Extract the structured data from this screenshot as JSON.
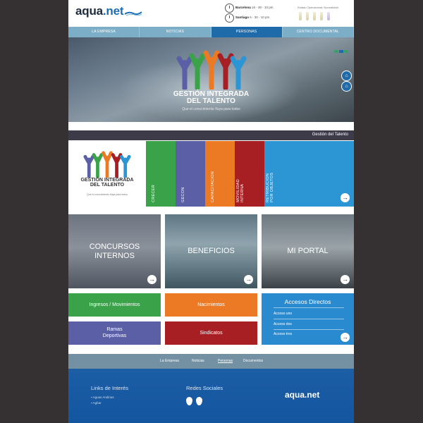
{
  "header": {
    "logo_main": "aqua",
    "logo_suffix": ".net",
    "clock1_city": "Barcelona",
    "clock1_time": "16 - 30 - 10 pm",
    "clock2_city": "Santiago",
    "clock2_time": "6 - 30 - 10 pm",
    "status_text": "Estado Operacional: Normalidad"
  },
  "nav": {
    "items": [
      "LA EMPRESA",
      "NOTICIAS",
      "PERSONAS",
      "CENTRO DOCUMENTAL"
    ],
    "active_index": 2
  },
  "hero": {
    "title_line1": "GESTIÓN INTEGRADA",
    "title_line2": "DEL TALENTO",
    "subtitle": "Que el conocimiento fluya para todos"
  },
  "strip": {
    "label": "Gestión del Talento"
  },
  "talent_tile": {
    "title_line1": "GESTIÓN INTEGRADA",
    "title_line2": "DEL TALENTO",
    "subtitle": "Que el conocimiento fluya para todos"
  },
  "color_tiles": [
    {
      "label": "CRECER",
      "color": "#3aa34a"
    },
    {
      "label": "GECON",
      "color": "#5a5fa6"
    },
    {
      "label": "CAPACITACION",
      "color": "#ec7a24"
    },
    {
      "label": "MOVILIDAD INTERNA",
      "color": "#a71f22"
    },
    {
      "label": "RETRIBUCION POR OBJETOS",
      "color": "#2c95d4"
    }
  ],
  "photo_tiles": [
    {
      "title_line1": "CONCURSOS",
      "title_line2": "INTERNOS"
    },
    {
      "title_line1": "BENEFICIOS",
      "title_line2": ""
    },
    {
      "title_line1": "MI PORTAL",
      "title_line2": ""
    }
  ],
  "small_tiles": {
    "ingresos": "Ingresos / Movimientos",
    "nacimientos": "Nacimientos",
    "ramas_line1": "Ramas",
    "ramas_line2": "Deportivas",
    "sindicatos": "Sindicatos"
  },
  "accesos": {
    "title": "Accesos Directos",
    "items": [
      "Acceso uno",
      "Acceso dos",
      "Acceso tres"
    ]
  },
  "bottom_nav": {
    "items": [
      "La Empresa",
      "Noticias",
      "Personas",
      "Documentos"
    ]
  },
  "footer": {
    "links_heading": "Links de Interés",
    "links": [
      "Aguas Andinas",
      "Agbar"
    ],
    "social_heading": "Redes Sociales",
    "logo_main": "aqua",
    "logo_suffix": ".net"
  },
  "colors": {
    "accent_blue": "#1f6aa8",
    "green": "#3aa34a",
    "orange": "#ec7a24",
    "red": "#a71f22",
    "light_blue": "#2c95d4"
  },
  "icons": [
    "clock-icon",
    "home-icon",
    "arrow-right-icon",
    "drop-icon",
    "people-icon"
  ]
}
